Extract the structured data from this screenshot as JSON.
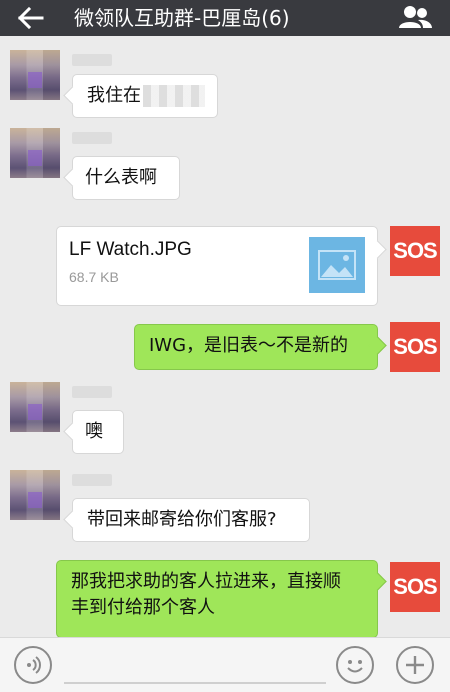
{
  "header": {
    "title": "微领队互助群-巴厘岛(6)",
    "back_icon": "back-arrow-icon",
    "contacts_icon": "group-members-icon"
  },
  "messages": [
    {
      "side": "left",
      "text": "我住在",
      "redacted": true
    },
    {
      "side": "left",
      "text": "什么表啊"
    },
    {
      "side": "right",
      "type": "file",
      "file_name": "LF Watch.JPG",
      "file_size": "68.7 KB",
      "avatar_label": "SOS"
    },
    {
      "side": "right",
      "text": "IWG，是旧表～不是新的",
      "avatar_label": "SOS"
    },
    {
      "side": "left",
      "text": "噢"
    },
    {
      "side": "left",
      "text": "带回来邮寄给你们客服?"
    },
    {
      "side": "right",
      "text_line1": "那我把求助的客人拉进来，直接顺",
      "text_line2": "丰到付给那个客人",
      "avatar_label": "SOS"
    }
  ],
  "input_bar": {
    "voice_icon": "voice-icon",
    "emoji_icon": "emoji-icon",
    "plus_icon": "plus-icon"
  },
  "colors": {
    "header_bg": "#393a3f",
    "chat_bg": "#ebebeb",
    "sent_bubble": "#9fe659",
    "sos_red": "#e74b3c"
  }
}
